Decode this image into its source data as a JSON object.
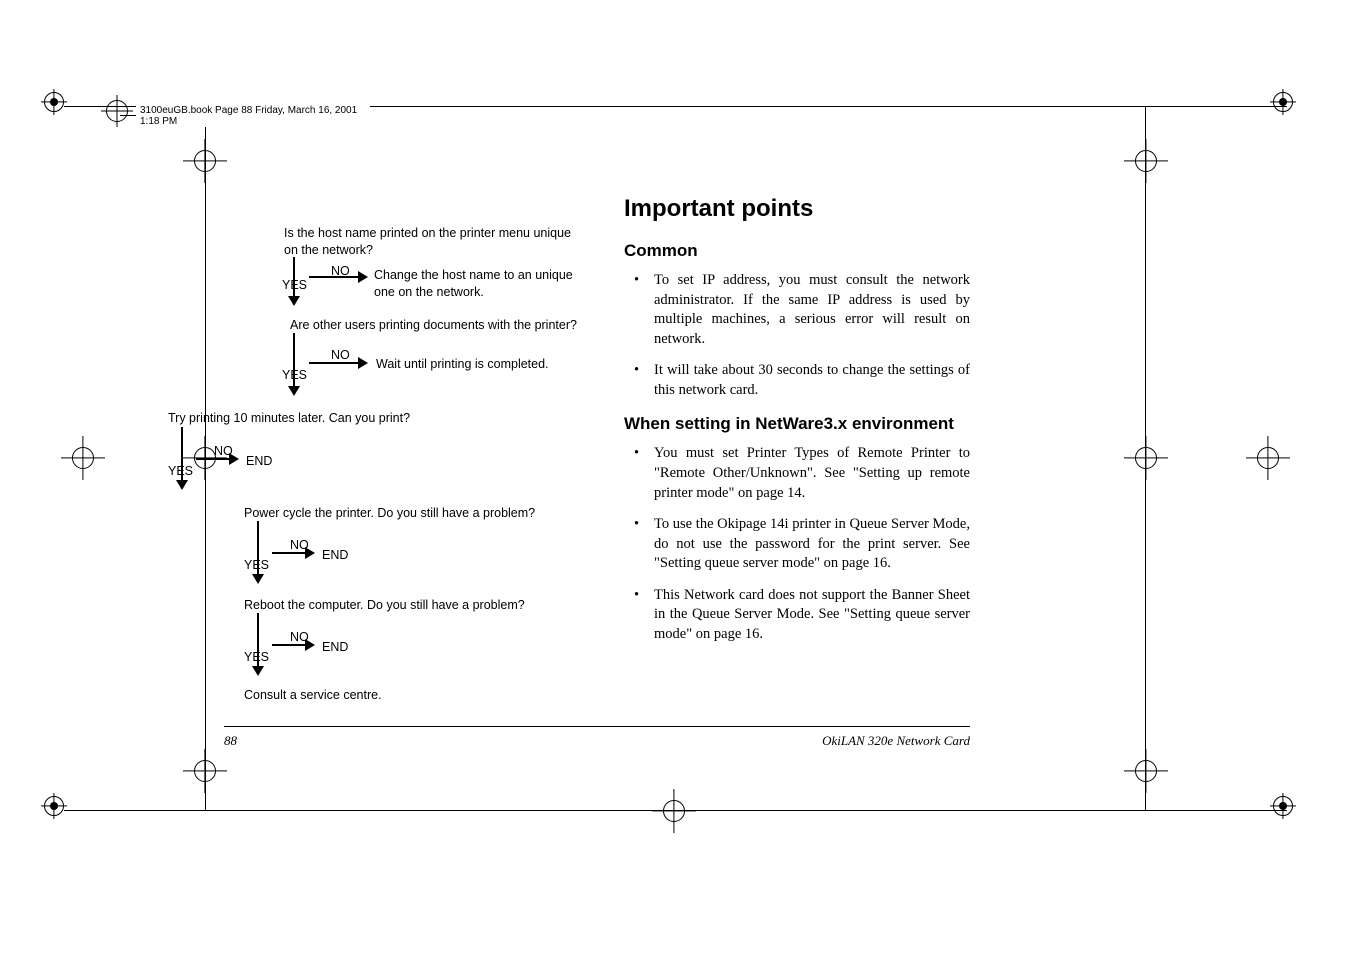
{
  "header": {
    "tab_text": "3100euGB.book  Page 88  Friday, March 16, 2001  1:18 PM"
  },
  "flowchart": {
    "q1": "Is the host name printed on the printer menu unique on the network?",
    "yes": "YES",
    "no": "NO",
    "a1": "Change the host name to an unique one on the network.",
    "q2": "Are other users printing documents with the printer?",
    "a2": "Wait until printing is completed.",
    "q3": "Try printing 10 minutes later. Can you print?",
    "end": "END",
    "q4": "Power cycle the printer. Do you still have a problem?",
    "q5": "Reboot the computer. Do you still have a problem?",
    "final": "Consult a service centre."
  },
  "right": {
    "title": "Important points",
    "sec1_title": "Common",
    "sec1_b1": "To set IP address, you must consult the network administrator. If the same IP address is used by multiple machines, a serious error will result on network.",
    "sec1_b2": "It will take about 30 seconds to change the settings of this network card.",
    "sec2_title": "When setting in NetWare3.x environment",
    "sec2_b1": "You must set Printer Types of Remote Printer to \"Remote Other/Unknown\". See \"Setting up remote printer mode\" on page 14.",
    "sec2_b2": "To use the Okipage 14i printer in Queue Server Mode, do not use the password for the print server. See \"Setting queue server mode\" on page 16.",
    "sec2_b3": "This Network card does not support the Banner Sheet in the Queue Server Mode. See \"Setting queue server mode\" on page 16."
  },
  "footer": {
    "page": "88",
    "doc": "OkiLAN 320e Network Card"
  }
}
